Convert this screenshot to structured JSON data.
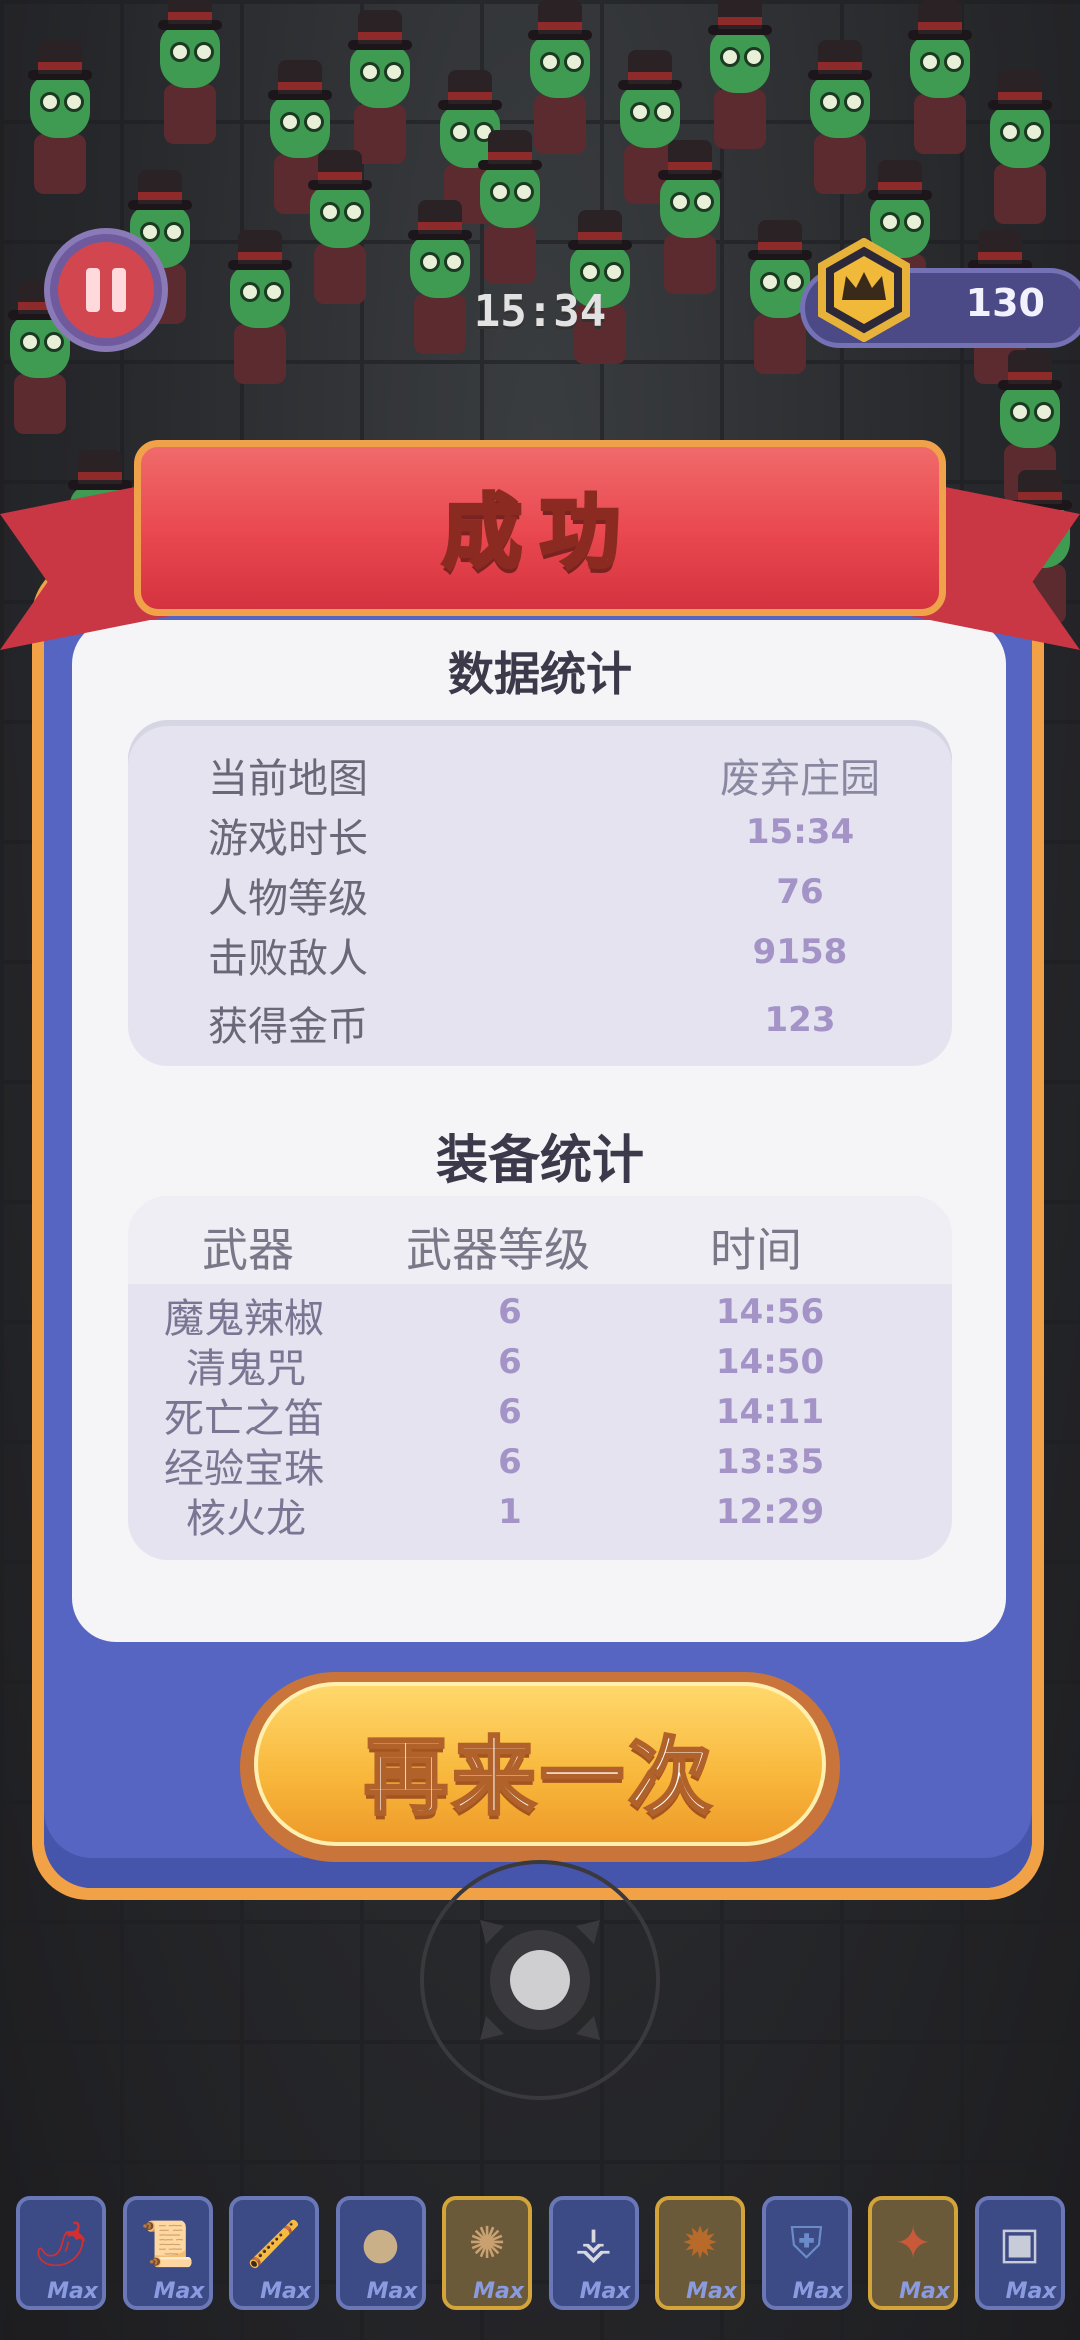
{
  "hud": {
    "timer": "15:34",
    "coins": "130"
  },
  "result": {
    "title": "成功",
    "stats_title": "数据统计",
    "stats": [
      {
        "label": "当前地图",
        "value": "废弃庄园"
      },
      {
        "label": "游戏时长",
        "value": "15:34"
      },
      {
        "label": "人物等级",
        "value": "76"
      },
      {
        "label": "击败敌人",
        "value": "9158"
      },
      {
        "label": "获得金币",
        "value": "123"
      }
    ],
    "equip_title": "装备统计",
    "equip_headers": [
      "武器",
      "武器等级",
      "时间"
    ],
    "equip_rows": [
      {
        "weapon": "魔鬼辣椒",
        "level": "6",
        "time": "14:56"
      },
      {
        "weapon": "清鬼咒",
        "level": "6",
        "time": "14:50"
      },
      {
        "weapon": "死亡之笛",
        "level": "6",
        "time": "14:11"
      },
      {
        "weapon": "经验宝珠",
        "level": "6",
        "time": "13:35"
      },
      {
        "weapon": "核火龙",
        "level": "1",
        "time": "12:29"
      }
    ],
    "retry_label": "再来一次"
  },
  "weapon_bar": [
    {
      "icon": "chili-icon",
      "max": "Max",
      "gold": false
    },
    {
      "icon": "scroll-icon",
      "max": "Max",
      "gold": false
    },
    {
      "icon": "flute-icon",
      "max": "Max",
      "gold": false
    },
    {
      "icon": "orb-icon",
      "max": "Max",
      "gold": false
    },
    {
      "icon": "brain-icon",
      "max": "Max",
      "gold": true
    },
    {
      "icon": "dragon-icon",
      "max": "Max",
      "gold": false
    },
    {
      "icon": "bomb-icon",
      "max": "Max",
      "gold": true
    },
    {
      "icon": "armor-icon",
      "max": "Max",
      "gold": false
    },
    {
      "icon": "gun-icon",
      "max": "Max",
      "gold": true
    },
    {
      "icon": "tablet-icon",
      "max": "Max",
      "gold": false
    }
  ],
  "colors": {
    "panel_blue": "#5565c1",
    "ribbon_red": "#e9474f",
    "accent_orange": "#f1a247",
    "value_purple": "#a493c6"
  }
}
